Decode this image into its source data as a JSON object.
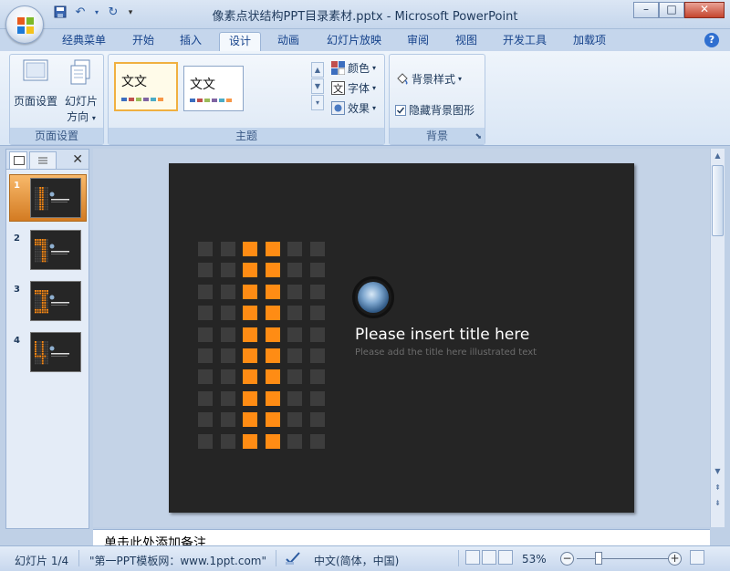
{
  "window": {
    "title": "像素点状结构PPT目录素材.pptx - Microsoft PowerPoint",
    "qat_icons": [
      "save-icon",
      "undo-icon",
      "redo-icon",
      "customize-icon"
    ]
  },
  "tabs": [
    {
      "label": "经典菜单"
    },
    {
      "label": "开始"
    },
    {
      "label": "插入"
    },
    {
      "label": "设计",
      "active": true
    },
    {
      "label": "动画"
    },
    {
      "label": "幻灯片放映"
    },
    {
      "label": "审阅"
    },
    {
      "label": "视图"
    },
    {
      "label": "开发工具"
    },
    {
      "label": "加载项"
    }
  ],
  "ribbon": {
    "page_setup_group": {
      "label": "页面设置",
      "page_setup_button": "页面设置",
      "orientation_button_line1": "幻灯片",
      "orientation_button_line2": "方向"
    },
    "themes_group": {
      "label": "主题",
      "theme1_text": "文文",
      "theme2_text": "文文",
      "colors": "颜色",
      "fonts": "字体",
      "effects": "效果",
      "theme1_bar_colors": [
        "#3c6ebf",
        "#c0504d",
        "#9bbb59",
        "#8064a2",
        "#4bacc6",
        "#f79646"
      ],
      "theme2_bar_colors": [
        "#3c6ebf",
        "#c0504d",
        "#9bbb59",
        "#8064a2",
        "#4bacc6",
        "#f79646"
      ]
    },
    "background_group": {
      "label": "背景",
      "background_styles": "背景样式",
      "hide_background_graphics": "隐藏背景图形",
      "hide_checked": true
    }
  },
  "slides_pane": {
    "thumbnails": [
      {
        "number": "1",
        "selected": true
      },
      {
        "number": "2"
      },
      {
        "number": "3"
      },
      {
        "number": "4"
      }
    ]
  },
  "slide": {
    "title": "Please insert title here",
    "subtitle": "Please add the title here illustrated text",
    "grid": {
      "rows": 10,
      "cols": 6,
      "orange_cols": [
        2,
        3
      ],
      "orange_color": "#ff8c14",
      "gray_color": "#3d3d3d",
      "background_color": "#252525"
    }
  },
  "notes": {
    "placeholder": "单击此处添加备注"
  },
  "status": {
    "slide_counter": "幻灯片 1/4",
    "theme_name": "\"第一PPT模板网：www.1ppt.com\"",
    "language": "中文(简体，中国)",
    "zoom": "53%"
  }
}
